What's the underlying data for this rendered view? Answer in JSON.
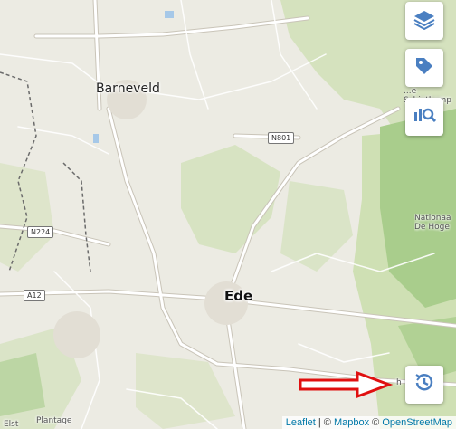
{
  "map": {
    "places": {
      "barneveld": "Barneveld",
      "ede": "Ede",
      "schietkamp": "...e Schietkamp",
      "nationaal": "Nationaa De Hoge",
      "plantage": "Plantage",
      "elst": "Elst",
      "bottom_right_fragment": "h"
    },
    "roads": {
      "n801": "N801",
      "n224": "N224",
      "a12": "A12"
    },
    "colors": {
      "land": "#ecebe3",
      "forest": "#cfe0b4",
      "dense_forest": "#a9cd8c",
      "road": "#ffffff",
      "road_casing": "#c9c4b8",
      "water": "#a6c8e8",
      "boundary": "#6b6b6b",
      "annotation_arrow": "#e01010"
    }
  },
  "controls": {
    "layers": {
      "icon": "layers-icon"
    },
    "tags": {
      "icon": "tag-icon"
    },
    "search_analysis": {
      "icon": "search-chart-icon"
    },
    "history": {
      "icon": "clock-history-icon"
    }
  },
  "attribution": {
    "leaflet": "Leaflet",
    "sep": "|",
    "mapbox_prefix": "©",
    "mapbox": "Mapbox",
    "osm_prefix": "©",
    "osm": "OpenStreetMap"
  }
}
